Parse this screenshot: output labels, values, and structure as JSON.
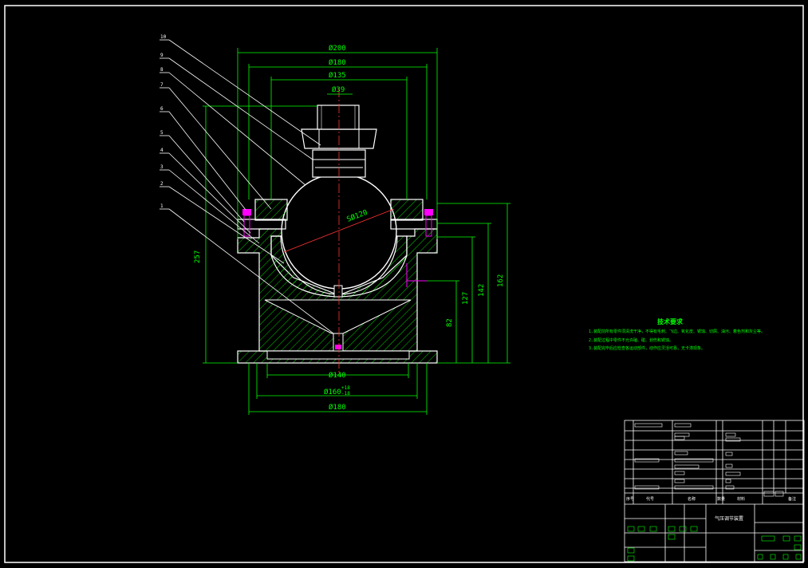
{
  "dimensions": {
    "top_d200": "Ø200",
    "top_d180": "Ø180",
    "top_d135": "Ø135",
    "top_d39": "Ø39",
    "sphere": "SØ120",
    "h257": "257",
    "h162": "162",
    "h142": "142",
    "h127": "127",
    "h82": "82",
    "bot_d140": "Ø140",
    "bot_d160": "Ø160",
    "bot_d160_tol_upper": "+18",
    "bot_d160_tol_lower": "-18",
    "bot_d180": "Ø180"
  },
  "part_numbers": [
    "10",
    "9",
    "8",
    "7",
    "6",
    "5",
    "4",
    "3",
    "2",
    "1"
  ],
  "notes": {
    "title": "技术要求",
    "lines": [
      "1.装配前所有零件须清洗干净，不得有毛刺、飞边、氧化皮、锈蚀、切屑、油污、着色剂和灰尘等。",
      "2.装配过程中零件不允许磕、碰、划伤和锈蚀。",
      "3.装配完毕后应检查各运动部件，动作应灵活可靠，无卡滞现象。"
    ]
  },
  "title_block": {
    "drawing_name": "气压调节装置",
    "col_seq": "序号",
    "col_code": "代号",
    "col_name": "名称",
    "col_qty": "数量",
    "col_material": "材料",
    "col_note": "备注"
  },
  "colors": {
    "outline": "#ffffff",
    "dimension": "#00ff00",
    "leader": "#ffffff",
    "hatch": "#00ff00",
    "centerline": "#ff3333",
    "bolt": "#ff00ff",
    "frame": "#ffffff"
  }
}
